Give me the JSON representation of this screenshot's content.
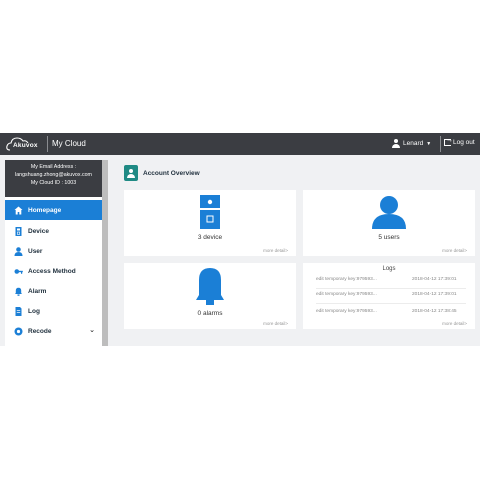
{
  "header": {
    "logo_text": "Akuvox",
    "app_title": "My Cloud",
    "user_name": "Lenard",
    "logout_label": "Log out"
  },
  "sidebar": {
    "account": {
      "email_label": "My Email Address :",
      "email": "langshuang.zhong@akuvox.com",
      "cloud_id": "My Cloud ID : 1003"
    },
    "items": [
      {
        "label": "Homepage",
        "icon": "home-icon",
        "active": true
      },
      {
        "label": "Device",
        "icon": "device-icon"
      },
      {
        "label": "User",
        "icon": "user-icon"
      },
      {
        "label": "Access Method",
        "icon": "key-icon"
      },
      {
        "label": "Alarm",
        "icon": "bell-icon"
      },
      {
        "label": "Log",
        "icon": "log-icon"
      },
      {
        "label": "Recode",
        "icon": "recode-icon",
        "expandable": true
      }
    ]
  },
  "overview": {
    "title": "Account Overview",
    "device_value": "3 device",
    "users_value": "5 users",
    "alarms_value": "0 alarms",
    "more_label": "more detail>",
    "logs_title": "Logs",
    "logs": [
      {
        "text": "edit temporary key:979593...",
        "date": "2018-04-12 17:39:01"
      },
      {
        "text": "edit temporary key:979593...",
        "date": "2018-04-12 17:39:01"
      },
      {
        "text": "edit temporary key:979593...",
        "date": "2018-04-12 17:38:45"
      }
    ]
  },
  "colors": {
    "accent": "#1b7fd6",
    "topbar": "#3b3d42",
    "overview_icon": "#1f8a84"
  }
}
